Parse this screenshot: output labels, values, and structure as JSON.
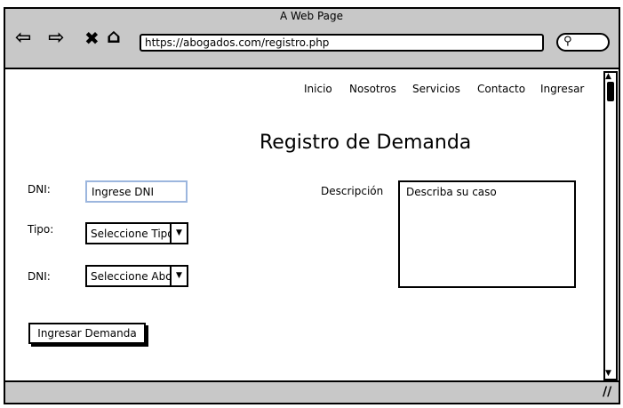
{
  "browser": {
    "window_title": "A Web Page",
    "url": "https://abogados.com/registro.php",
    "icons": [
      "back-arrow-icon",
      "forward-arrow-icon",
      "stop-icon",
      "home-icon",
      "search-icon",
      "resize-handle-icon"
    ]
  },
  "nav": {
    "items": [
      "Inicio",
      "Nosotros",
      "Servicios",
      "Contacto",
      "Ingresar"
    ]
  },
  "page": {
    "title": "Registro de Demanda"
  },
  "form": {
    "dni_label": "DNI:",
    "dni_placeholder": "Ingrese DNI",
    "tipo_label": "Tipo:",
    "tipo_value": "Seleccione Tipo",
    "abogado_label": "DNI:",
    "abogado_value": "Seleccione Abogado",
    "descripcion_label": "Descripción",
    "descripcion_placeholder": "Describa su caso",
    "submit_label": "Ingresar Demanda"
  }
}
